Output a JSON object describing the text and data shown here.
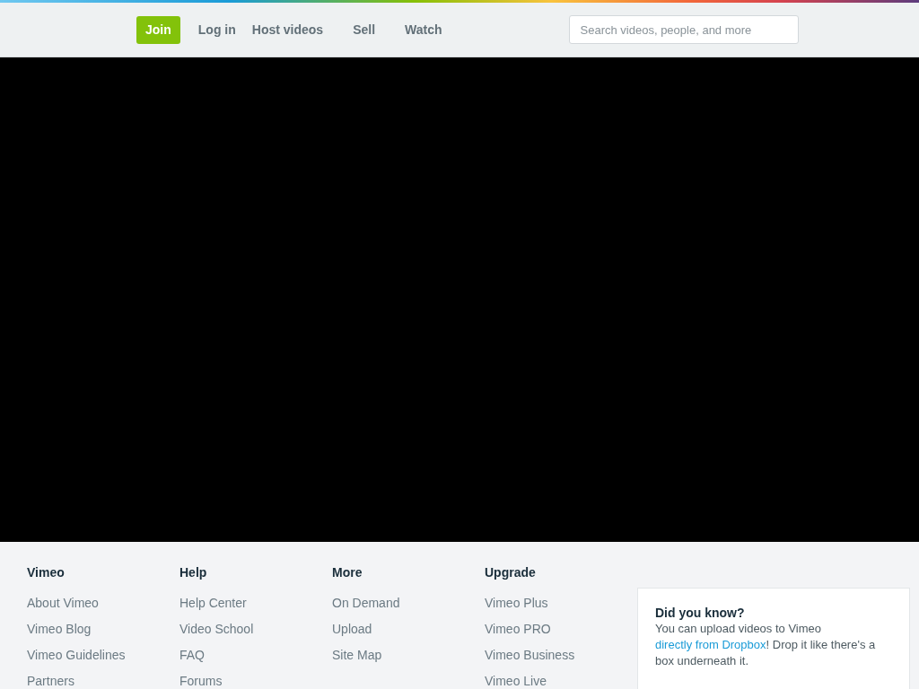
{
  "header": {
    "nav": [
      {
        "label": "Join",
        "kind": "primary"
      },
      {
        "label": "Log in",
        "kind": "link"
      },
      {
        "label": "Host videos",
        "kind": "link"
      },
      {
        "label": "Sell",
        "kind": "link"
      },
      {
        "label": "Watch",
        "kind": "link"
      }
    ],
    "search": {
      "placeholder": "Search videos, people, and more"
    }
  },
  "footer": {
    "columns": [
      {
        "heading": "Vimeo",
        "links": [
          "About Vimeo",
          "Vimeo Blog",
          "Vimeo Guidelines",
          "Partners"
        ]
      },
      {
        "heading": "Help",
        "links": [
          "Help Center",
          "Video School",
          "FAQ",
          "Forums"
        ]
      },
      {
        "heading": "More",
        "links": [
          "On Demand",
          "Upload",
          "Site Map"
        ]
      },
      {
        "heading": "Upgrade",
        "links": [
          "Vimeo Plus",
          "Vimeo PRO",
          "Vimeo Business",
          "Vimeo Live"
        ]
      }
    ],
    "tip": {
      "title": "Did you know?",
      "text_before": "You can upload videos to Vimeo ",
      "link": "directly from Dropbox",
      "text_after": "! Drop it like there's a box underneath it."
    }
  }
}
